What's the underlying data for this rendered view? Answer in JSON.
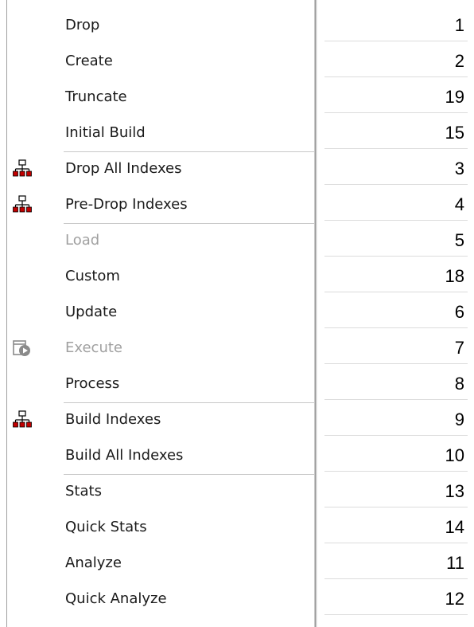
{
  "menu": {
    "items": [
      {
        "label": "Drop",
        "icon": "",
        "disabled": false,
        "separator_before": false
      },
      {
        "label": "Create",
        "icon": "",
        "disabled": false,
        "separator_before": false
      },
      {
        "label": "Truncate",
        "icon": "",
        "disabled": false,
        "separator_before": false
      },
      {
        "label": "Initial Build",
        "icon": "",
        "disabled": false,
        "separator_before": false
      },
      {
        "label": "Drop All Indexes",
        "icon": "index-hierarchy-icon",
        "disabled": false,
        "separator_before": true
      },
      {
        "label": "Pre-Drop Indexes",
        "icon": "index-hierarchy-icon",
        "disabled": false,
        "separator_before": false
      },
      {
        "label": "Load",
        "icon": "",
        "disabled": true,
        "separator_before": true
      },
      {
        "label": "Custom",
        "icon": "",
        "disabled": false,
        "separator_before": false
      },
      {
        "label": "Update",
        "icon": "",
        "disabled": false,
        "separator_before": false
      },
      {
        "label": "Execute",
        "icon": "execute-icon",
        "disabled": true,
        "separator_before": false
      },
      {
        "label": "Process",
        "icon": "",
        "disabled": false,
        "separator_before": false
      },
      {
        "label": "Build Indexes",
        "icon": "index-hierarchy-icon",
        "disabled": false,
        "separator_before": true
      },
      {
        "label": "Build All Indexes",
        "icon": "",
        "disabled": false,
        "separator_before": false
      },
      {
        "label": "Stats",
        "icon": "",
        "disabled": false,
        "separator_before": true
      },
      {
        "label": "Quick Stats",
        "icon": "",
        "disabled": false,
        "separator_before": false
      },
      {
        "label": "Analyze",
        "icon": "",
        "disabled": false,
        "separator_before": false
      },
      {
        "label": "Quick Analyze",
        "icon": "",
        "disabled": false,
        "separator_before": false
      }
    ]
  },
  "values": [
    "1",
    "2",
    "19",
    "15",
    "3",
    "4",
    "5",
    "18",
    "6",
    "7",
    "8",
    "9",
    "10",
    "13",
    "14",
    "11",
    "12"
  ],
  "colors": {
    "index_icon": "#c00000",
    "index_icon_stroke": "#000000",
    "execute_icon": "#8a8a8a",
    "disabled_text": "#a0a0a0",
    "text": "#1a1a1a"
  }
}
